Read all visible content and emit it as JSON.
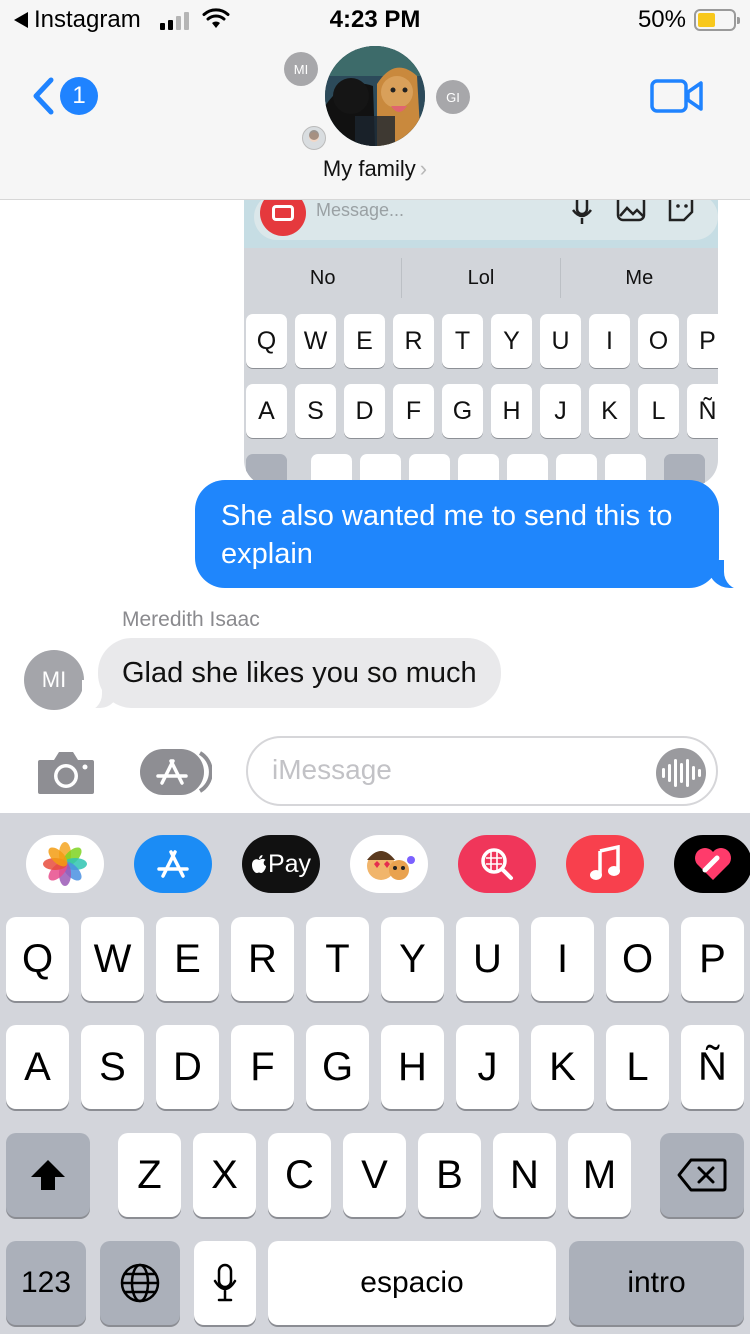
{
  "status_bar": {
    "back_app": "Instagram",
    "time": "4:23 PM",
    "battery_percent": "50%",
    "battery_level": 0.5,
    "battery_color": "#f8c81c"
  },
  "nav": {
    "unread_count": "1",
    "group_name": "My family",
    "member_initials_left": "MI",
    "member_initials_right": "GI",
    "accent_color": "#1f83ff"
  },
  "embedded_screenshot": {
    "input_placeholder": "Message...",
    "suggestions": [
      "No",
      "Lol",
      "Me"
    ],
    "row1": [
      "Q",
      "W",
      "E",
      "R",
      "T",
      "Y",
      "U",
      "I",
      "O",
      "P"
    ],
    "row2": [
      "A",
      "S",
      "D",
      "F",
      "G",
      "H",
      "J",
      "K",
      "L",
      "Ñ"
    ]
  },
  "messages": {
    "outgoing_text": "She also wanted me to send this to explain",
    "sender_name": "Meredith Isaac",
    "sender_initials": "MI",
    "incoming_text": "Glad she likes you so much",
    "outgoing_color": "#1f86fc"
  },
  "input_bar": {
    "placeholder": "iMessage"
  },
  "app_drawer": {
    "apps": [
      "photos-app-icon",
      "app-store-icon",
      "apple-pay-icon",
      "memoji-icon",
      "search-images-icon",
      "music-icon",
      "digital-touch-icon"
    ],
    "apple_pay_label": "Pay"
  },
  "keyboard": {
    "row1": [
      "Q",
      "W",
      "E",
      "R",
      "T",
      "Y",
      "U",
      "I",
      "O",
      "P"
    ],
    "row2": [
      "A",
      "S",
      "D",
      "F",
      "G",
      "H",
      "J",
      "K",
      "L",
      "Ñ"
    ],
    "row3": [
      "Z",
      "X",
      "C",
      "V",
      "B",
      "N",
      "M"
    ],
    "numbers_label": "123",
    "space_label": "espacio",
    "return_label": "intro"
  }
}
